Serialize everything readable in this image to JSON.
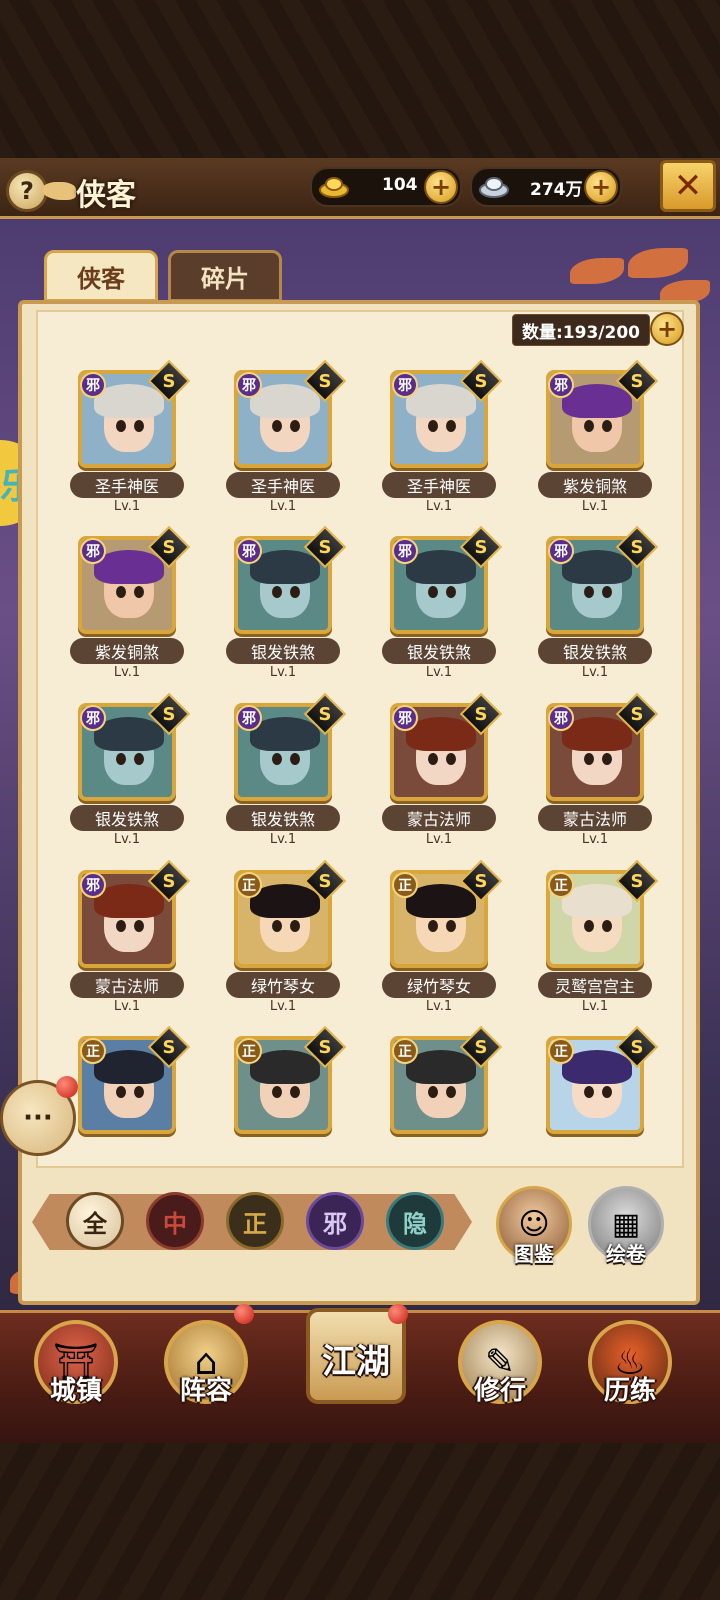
{
  "header": {
    "title": "侠客",
    "help_icon": "question-icon",
    "gold": {
      "icon": "gold-ingot-icon",
      "value": "104"
    },
    "silver": {
      "icon": "silver-ingot-icon",
      "value": "274万"
    },
    "add_symbol": "+",
    "close_icon": "crossed-swords-icon"
  },
  "tabs": [
    {
      "label": "侠客",
      "active": true
    },
    {
      "label": "碎片",
      "active": false
    }
  ],
  "capacity": {
    "label": "数量:193/200"
  },
  "heroes": [
    {
      "name": "圣手神医",
      "level": "Lv.1",
      "faction": "邪",
      "rank": "S",
      "skin": "#f3d6bf",
      "hair": "#d9d6cf",
      "bg": "#8fb1c8"
    },
    {
      "name": "圣手神医",
      "level": "Lv.1",
      "faction": "邪",
      "rank": "S",
      "skin": "#f3d6bf",
      "hair": "#d9d6cf",
      "bg": "#8fb1c8"
    },
    {
      "name": "圣手神医",
      "level": "Lv.1",
      "faction": "邪",
      "rank": "S",
      "skin": "#f3d6bf",
      "hair": "#d9d6cf",
      "bg": "#8fb1c8"
    },
    {
      "name": "紫发铜煞",
      "level": "Lv.1",
      "faction": "邪",
      "rank": "S",
      "skin": "#f0c7a8",
      "hair": "#6a2f92",
      "bg": "#b59a72"
    },
    {
      "name": "紫发铜煞",
      "level": "Lv.1",
      "faction": "邪",
      "rank": "S",
      "skin": "#f0c7a8",
      "hair": "#6a2f92",
      "bg": "#b59a72"
    },
    {
      "name": "银发铁煞",
      "level": "Lv.1",
      "faction": "邪",
      "rank": "S",
      "skin": "#a6c9cc",
      "hair": "#2b3a44",
      "bg": "#5b8a86"
    },
    {
      "name": "银发铁煞",
      "level": "Lv.1",
      "faction": "邪",
      "rank": "S",
      "skin": "#a6c9cc",
      "hair": "#2b3a44",
      "bg": "#5b8a86"
    },
    {
      "name": "银发铁煞",
      "level": "Lv.1",
      "faction": "邪",
      "rank": "S",
      "skin": "#a6c9cc",
      "hair": "#2b3a44",
      "bg": "#5b8a86"
    },
    {
      "name": "银发铁煞",
      "level": "Lv.1",
      "faction": "邪",
      "rank": "S",
      "skin": "#a6c9cc",
      "hair": "#2b3a44",
      "bg": "#5b8a86"
    },
    {
      "name": "银发铁煞",
      "level": "Lv.1",
      "faction": "邪",
      "rank": "S",
      "skin": "#a6c9cc",
      "hair": "#2b3a44",
      "bg": "#5b8a86"
    },
    {
      "name": "蒙古法师",
      "level": "Lv.1",
      "faction": "邪",
      "rank": "S",
      "skin": "#f2d8c4",
      "hair": "#7a2a16",
      "bg": "#7a4a3a"
    },
    {
      "name": "蒙古法师",
      "level": "Lv.1",
      "faction": "邪",
      "rank": "S",
      "skin": "#f2d8c4",
      "hair": "#7a2a16",
      "bg": "#7a4a3a"
    },
    {
      "name": "蒙古法师",
      "level": "Lv.1",
      "faction": "邪",
      "rank": "S",
      "skin": "#f2d8c4",
      "hair": "#7a2a16",
      "bg": "#7a4a3a"
    },
    {
      "name": "绿竹琴女",
      "level": "Lv.1",
      "faction": "正",
      "rank": "S",
      "skin": "#f6d7b6",
      "hair": "#1c1414",
      "bg": "#d8b46a"
    },
    {
      "name": "绿竹琴女",
      "level": "Lv.1",
      "faction": "正",
      "rank": "S",
      "skin": "#f6d7b6",
      "hair": "#1c1414",
      "bg": "#d8b46a"
    },
    {
      "name": "灵鹫宫宫主",
      "level": "Lv.1",
      "faction": "正",
      "rank": "S",
      "skin": "#f5dcc0",
      "hair": "#e9dfcf",
      "bg": "#cfd6a8"
    },
    {
      "name": "",
      "level": "",
      "faction": "正",
      "rank": "S",
      "skin": "#f1d2b8",
      "hair": "#1f2430",
      "bg": "#5b7ea4"
    },
    {
      "name": "",
      "level": "",
      "faction": "正",
      "rank": "S",
      "skin": "#f1d2b8",
      "hair": "#2a2a2a",
      "bg": "#6f8f8a"
    },
    {
      "name": "",
      "level": "",
      "faction": "正",
      "rank": "S",
      "skin": "#f1d2b8",
      "hair": "#2a2a2a",
      "bg": "#6f8f8a"
    },
    {
      "name": "",
      "level": "",
      "faction": "正",
      "rank": "S",
      "skin": "#f6dcc6",
      "hair": "#3b2a6e",
      "bg": "#b8d4e8"
    }
  ],
  "filters": [
    {
      "label": "全",
      "selected": true
    },
    {
      "label": "中",
      "selected": false
    },
    {
      "label": "正",
      "selected": false
    },
    {
      "label": "邪",
      "selected": false
    },
    {
      "label": "隐",
      "selected": false
    }
  ],
  "side_buttons": [
    {
      "label": "图鉴",
      "icon": "codex-portrait-icon"
    },
    {
      "label": "绘卷",
      "icon": "painting-scroll-icon"
    }
  ],
  "left_deco_text": "乐",
  "chat_icon": "chat-bubble-icon",
  "nav": [
    {
      "label": "城镇",
      "icon": "town-gate-icon",
      "badge": false
    },
    {
      "label": "阵容",
      "icon": "straw-hat-icon",
      "badge": true
    },
    {
      "label": "江湖",
      "icon": "scroll-icon",
      "badge": true
    },
    {
      "label": "修行",
      "icon": "scroll-bundle-icon",
      "badge": false
    },
    {
      "label": "历练",
      "icon": "cauldron-icon",
      "badge": false
    }
  ],
  "colors": {
    "faction_evil": "#5a2d8c",
    "faction_righteous": "#8a5a18",
    "accent_gold": "#d8a63a"
  }
}
